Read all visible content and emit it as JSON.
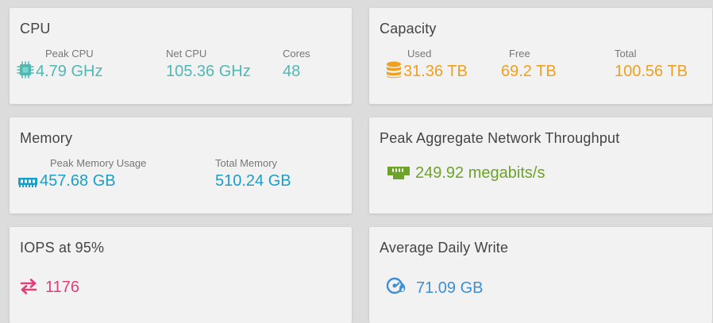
{
  "cpu": {
    "title": "CPU",
    "peak_label": "Peak CPU",
    "peak_value": "4.79 GHz",
    "net_label": "Net CPU",
    "net_value": "105.36 GHz",
    "cores_label": "Cores",
    "cores_value": "48",
    "icon": "cpu-chip-icon",
    "color": "#4fb8b2"
  },
  "capacity": {
    "title": "Capacity",
    "used_label": "Used",
    "used_value": "31.36 TB",
    "free_label": "Free",
    "free_value": "69.2 TB",
    "total_label": "Total",
    "total_value": "100.56 TB",
    "icon": "database-icon",
    "color": "#f0a020"
  },
  "memory": {
    "title": "Memory",
    "peak_label": "Peak Memory Usage",
    "peak_value": "457.68 GB",
    "total_label": "Total Memory",
    "total_value": "510.24 GB",
    "icon": "memory-stick-icon",
    "color": "#1a9fc9"
  },
  "network": {
    "title": "Peak Aggregate Network Throughput",
    "value": "249.92 megabits/s",
    "icon": "ethernet-port-icon",
    "color": "#6ea32b"
  },
  "iops": {
    "title": "IOPS at 95%",
    "value": "1176",
    "icon": "swap-arrows-icon",
    "color": "#e0407a"
  },
  "daily_write": {
    "title": "Average Daily Write",
    "value": "71.09 GB",
    "icon": "disk-write-icon",
    "color": "#3d8fd6"
  }
}
